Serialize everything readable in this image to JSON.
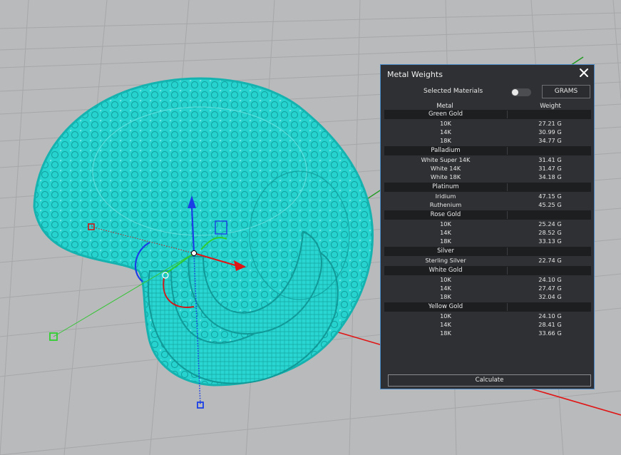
{
  "panel": {
    "title": "Metal Weights",
    "selected_materials_label": "Selected Materials",
    "unit_button": "GRAMS",
    "columns": {
      "metal": "Metal",
      "weight": "Weight"
    },
    "groups": [
      {
        "name": "Green Gold",
        "rows": [
          {
            "k": "10K",
            "w": "27.21 G"
          },
          {
            "k": "14K",
            "w": "30.99 G"
          },
          {
            "k": "18K",
            "w": "34.77 G"
          }
        ]
      },
      {
        "name": "Palladium",
        "rows": [
          {
            "k": "White Super 14K",
            "w": "31.41 G"
          },
          {
            "k": "White 14K",
            "w": "31.47 G"
          },
          {
            "k": "White 18K",
            "w": "34.18 G"
          }
        ]
      },
      {
        "name": "Platinum",
        "rows": [
          {
            "k": "Iridium",
            "w": "47.15 G"
          },
          {
            "k": "Ruthenium",
            "w": "45.25 G"
          }
        ]
      },
      {
        "name": "Rose Gold",
        "rows": [
          {
            "k": "10K",
            "w": "25.24 G"
          },
          {
            "k": "14K",
            "w": "28.52 G"
          },
          {
            "k": "18K",
            "w": "33.13 G"
          }
        ]
      },
      {
        "name": "Silver",
        "rows": [
          {
            "k": "Sterling Silver",
            "w": "22.74 G"
          }
        ]
      },
      {
        "name": "White Gold",
        "rows": [
          {
            "k": "10K",
            "w": "24.10 G"
          },
          {
            "k": "14K",
            "w": "27.47 G"
          },
          {
            "k": "18K",
            "w": "32.04 G"
          }
        ]
      },
      {
        "name": "Yellow Gold",
        "rows": [
          {
            "k": "10K",
            "w": "24.10 G"
          },
          {
            "k": "14K",
            "w": "28.41 G"
          },
          {
            "k": "18K",
            "w": "33.66 G"
          }
        ]
      }
    ],
    "calculate_button": "Calculate"
  },
  "colors": {
    "viewport_bg": "#b9babc",
    "grid": "#a6a7a9",
    "mesh": "#1ecfcc",
    "axis_x": "#e01515",
    "axis_y": "#1d9a1d",
    "gizmo_z": "#1a3fe6",
    "panel_bg": "#2f3033",
    "panel_border": "#4a89c7"
  }
}
